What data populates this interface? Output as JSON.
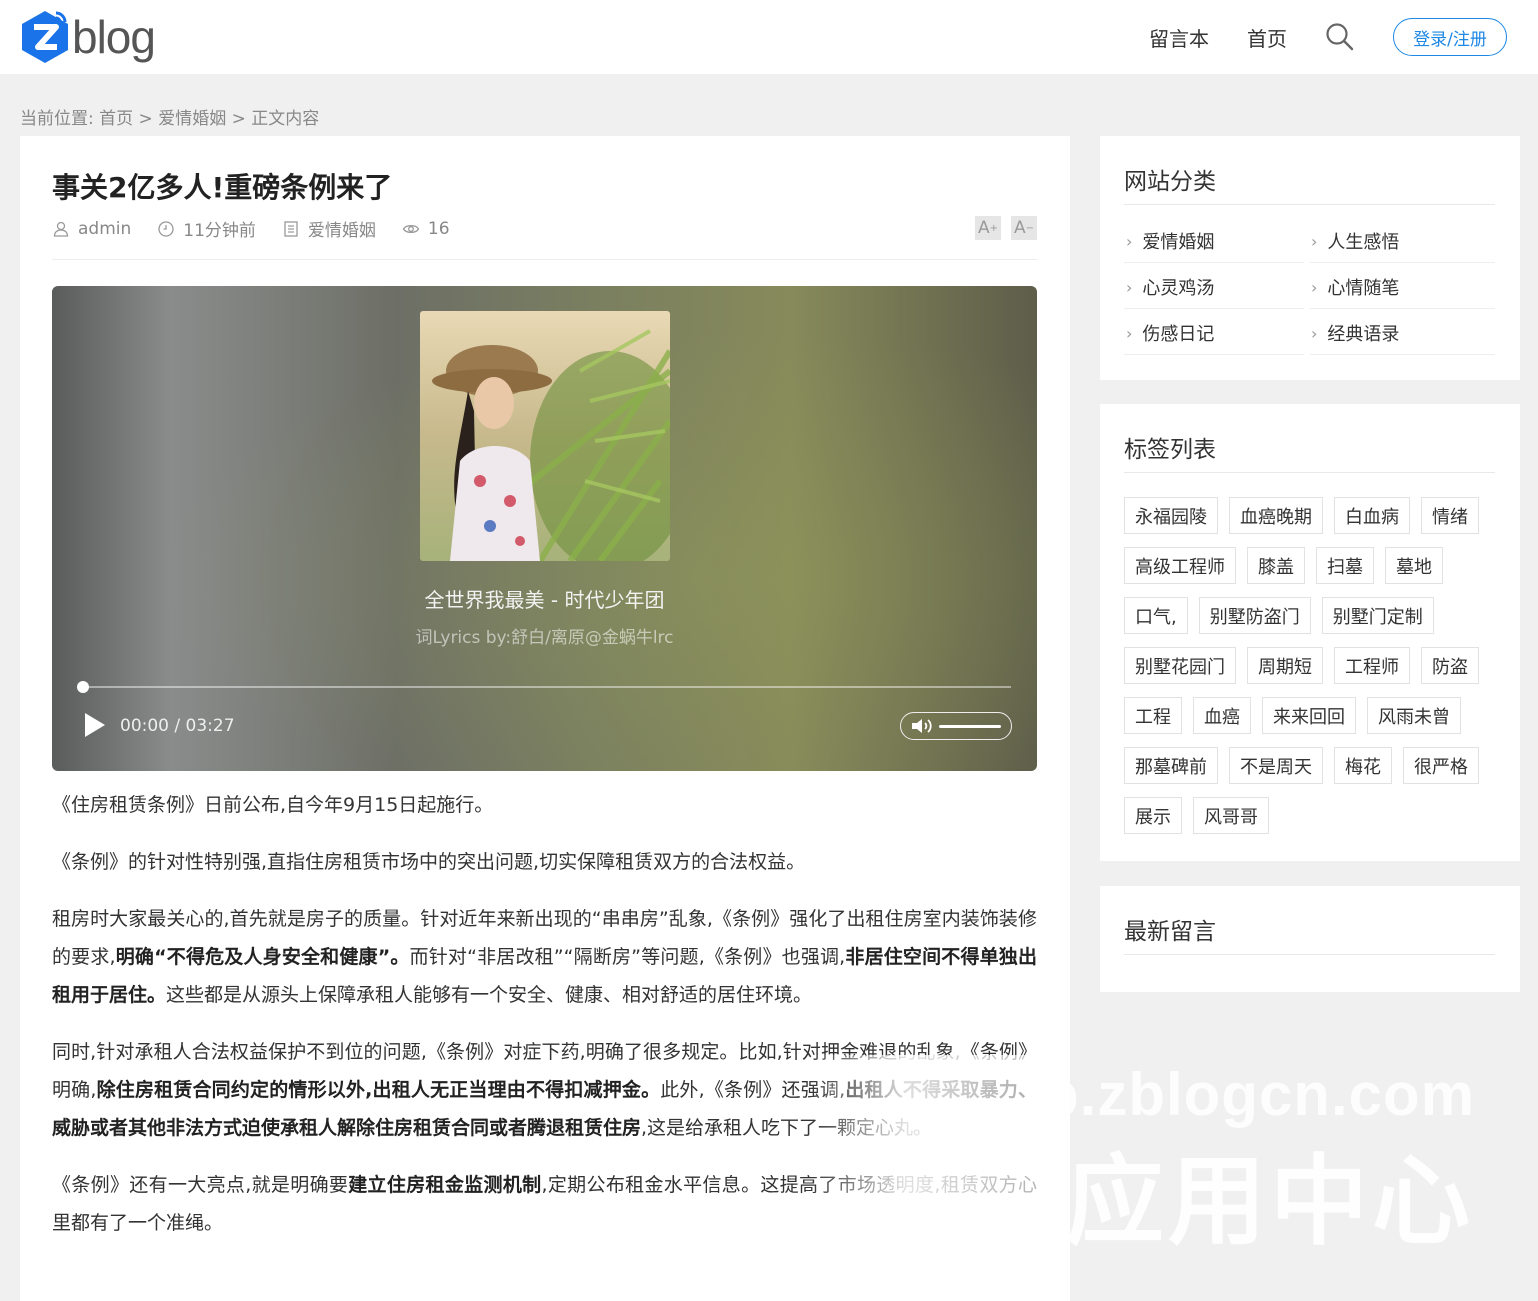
{
  "header": {
    "logo_text": "blog",
    "nav": [
      "留言本",
      "首页"
    ],
    "login_label": "登录/注册"
  },
  "breadcrumb": {
    "prefix": "当前位置:",
    "items": [
      "首页",
      "爱情婚姻",
      "正文内容"
    ],
    "separator": ">"
  },
  "post": {
    "title": "事关2亿多人!重磅条例来了",
    "author": "admin",
    "time": "11分钟前",
    "category": "爱情婚姻",
    "views": "16",
    "font_increase": "A",
    "font_decrease": "A"
  },
  "player": {
    "song_title": "全世界我最美 - 时代少年团",
    "lyric": "词Lyrics by:舒白/离原@金蜗牛lrc",
    "time": "00:00 / 03:27",
    "progress": 0,
    "volume": 1.0
  },
  "article": {
    "p1": "《住房租赁条例》日前公布,自今年9月15日起施行。",
    "p2": "《条例》的针对性特别强,直指住房租赁市场中的突出问题,切实保障租赁双方的合法权益。",
    "p3_a": "租房时大家最关心的,首先就是房子的质量。针对近年来新出现的“串串房”乱象,《条例》强化了出租住房室内装饰装修的要求,",
    "p3_b": "明确“不得危及人身安全和健康”。",
    "p3_c": "而针对“非居改租”“隔断房”等问题,《条例》也强调,",
    "p3_d": "非居住空间不得单独出租用于居住。",
    "p3_e": "这些都是从源头上保障承租人能够有一个安全、健康、相对舒适的居住环境。",
    "p4_a": "同时,针对承租人合法权益保护不到位的问题,《条例》对症下药,明确了很多规定。比如,针对押金难退的乱象,《条例》明确,",
    "p4_b": "除住房租赁合同约定的情形以外,出租人无正当理由不得扣减押金。",
    "p4_c": "此外,《条例》还强调,",
    "p4_d": "出租人不得采取暴力、威胁或者其他非法方式迫使承租人解除住房租赁合同或者腾退租赁住房",
    "p4_e": ",这是给承租人吃下了一颗定心丸。",
    "p5_a": "《条例》还有一大亮点,就是明确要",
    "p5_b": "建立住房租金监测机制",
    "p5_c": ",定期公布租金水平信息。这提高了市场透明度,租赁双方心里都有了一个准绳。"
  },
  "sidebar": {
    "categories_title": "网站分类",
    "categories": [
      "爱情婚姻",
      "人生感悟",
      "心灵鸡汤",
      "心情随笔",
      "伤感日记",
      "经典语录"
    ],
    "tags_title": "标签列表",
    "tags": [
      "永福园陵",
      "血癌晚期",
      "白血病",
      "情绪",
      "高级工程师",
      "膝盖",
      "扫墓",
      "墓地",
      "口气,",
      "别墅防盗门",
      "别墅门定制",
      "别墅花园门",
      "周期短",
      "工程师",
      "防盗",
      "工程",
      "血癌",
      "来来回回",
      "风雨未曾",
      "那墓碑前",
      "不是周天",
      "梅花",
      "很严格",
      "展示",
      "风哥哥"
    ],
    "comments_title": "最新留言"
  },
  "watermark": {
    "line1": "p.zblogcn.com",
    "line2": "应用中心"
  },
  "colors": {
    "accent": "#1e88e5",
    "logo_blue": "#1a73e8",
    "background": "#f0f0f0"
  }
}
